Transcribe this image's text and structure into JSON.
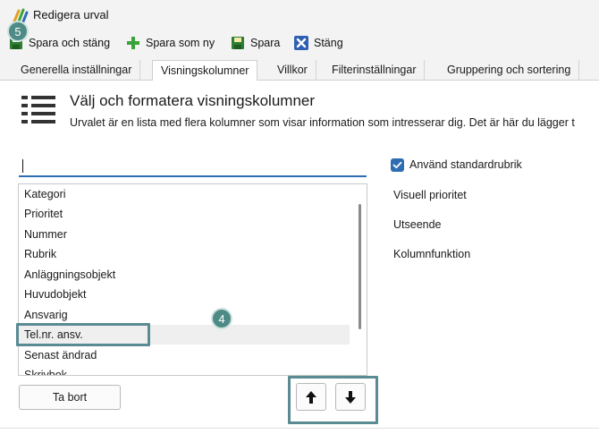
{
  "window": {
    "title": "Redigera urval"
  },
  "toolbar": {
    "save_close_label": "Spara och stäng",
    "save_as_new_label": "Spara som ny",
    "save_label": "Spara",
    "close_label": "Stäng"
  },
  "badges": {
    "step5": "5",
    "step4": "4"
  },
  "tabs": [
    {
      "label": "Generella inställningar",
      "active": false
    },
    {
      "label": "Visningskolumner",
      "active": true
    },
    {
      "label": "Villkor",
      "active": false
    },
    {
      "label": "Filterinställningar",
      "active": false
    },
    {
      "label": "Gruppering och sortering",
      "active": false
    }
  ],
  "header": {
    "title": "Välj och formatera visningskolumner",
    "description": "Urvalet är en lista med flera kolumner som visar information som intresserar dig. Det är här du lägger t"
  },
  "search": {
    "value": "",
    "placeholder": ""
  },
  "columns_list": {
    "items": [
      "Kategori",
      "Prioritet",
      "Nummer",
      "Rubrik",
      "Anläggningsobjekt",
      "Huvudobjekt",
      "Ansvarig",
      "Tel.nr. ansv.",
      "Senast ändrad",
      "Skrivbok"
    ],
    "selected": "Tel.nr. ansv."
  },
  "buttons": {
    "remove_label": "Ta bort",
    "move_up_icon": "arrow-up-icon",
    "move_down_icon": "arrow-down-icon"
  },
  "settings": {
    "use_default_header_label": "Använd standardrubrik",
    "use_default_header_checked": true,
    "visual_priority_label": "Visuell prioritet",
    "appearance_label": "Utseende",
    "column_function_label": "Kolumnfunktion"
  },
  "colors": {
    "accent": "#2f6db3",
    "badge": "#4f8b86",
    "highlight_border": "#5a8a92",
    "save_close_icon": "#2e7d32",
    "add_icon": "#3aa33a",
    "close_icon": "#2f5fb3"
  }
}
